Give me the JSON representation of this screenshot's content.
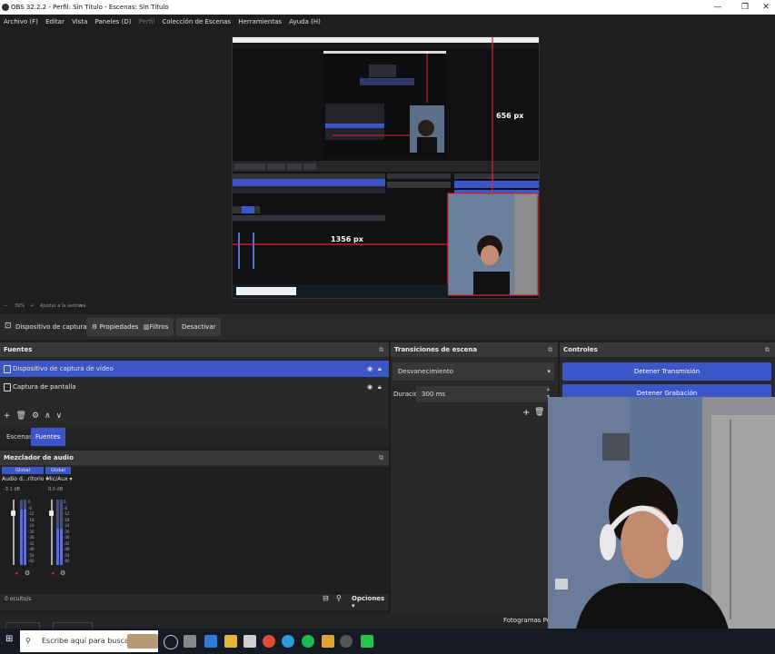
{
  "window": {
    "title": "OBS 32.2.2 - Perfil: Sin Título - Escenas: Sin Título",
    "minimize": "—",
    "maximize": "❐",
    "close": "✕"
  },
  "menu": [
    {
      "label": "Archivo (F)",
      "enabled": true
    },
    {
      "label": "Editar",
      "enabled": true
    },
    {
      "label": "Vista",
      "enabled": true
    },
    {
      "label": "Paneles (D)",
      "enabled": true
    },
    {
      "label": "Perfil",
      "enabled": false
    },
    {
      "label": "Colección de Escenas",
      "enabled": true
    },
    {
      "label": "Herramientas",
      "enabled": true
    },
    {
      "label": "Ayuda (H)",
      "enabled": true
    }
  ],
  "preview": {
    "height_measure": "656 px",
    "width_measure": "1356 px",
    "zoom_text": "39%",
    "fit_text": "Ajustar a la ventana",
    "measure_color": "#e0262f"
  },
  "source_toolbar": {
    "source_name": "Dispositivo de captura de v",
    "properties": "Propiedades",
    "filters": "Filtros",
    "deactivate": "Desactivar"
  },
  "sources": {
    "title": "Fuentes",
    "items": [
      {
        "label": "Dispositivo de captura de vídeo",
        "selected": true
      },
      {
        "label": "Captura de pantalla",
        "selected": false
      }
    ]
  },
  "bottom_tabs": [
    "Escenas",
    "Fuentes"
  ],
  "active_tab": "Fuentes",
  "transitions": {
    "title": "Transiciones de escena",
    "selected": "Desvanecimiento",
    "duration_label": "Duración",
    "duration_value": "300 ms"
  },
  "controls": {
    "title": "Controles",
    "stop_stream": "Detener Transmisión",
    "stop_record": "Detener Grabación",
    "accent": "#3b56c9"
  },
  "mixer": {
    "title": "Mezclador de audio",
    "channels": [
      {
        "badge": "Global",
        "name": "Audio d...ritorio",
        "db": "-3.1 dB",
        "level": 0.85,
        "volume": 1.0
      },
      {
        "badge": "Global",
        "name": "Mic/Aux",
        "db": "0.0 dB",
        "level": 0.55,
        "volume": 1.0
      }
    ],
    "scale": [
      "0",
      "-6",
      "-12",
      "-18",
      "-24",
      "-30",
      "-36",
      "-42",
      "-48",
      "-54",
      "-60"
    ],
    "hidden_count": "0 oculto/s",
    "options": "Opciones"
  },
  "status": {
    "frames": "Fotogramas Perdi"
  },
  "taskbar": {
    "search_placeholder": "Escribe aquí para buscar."
  }
}
